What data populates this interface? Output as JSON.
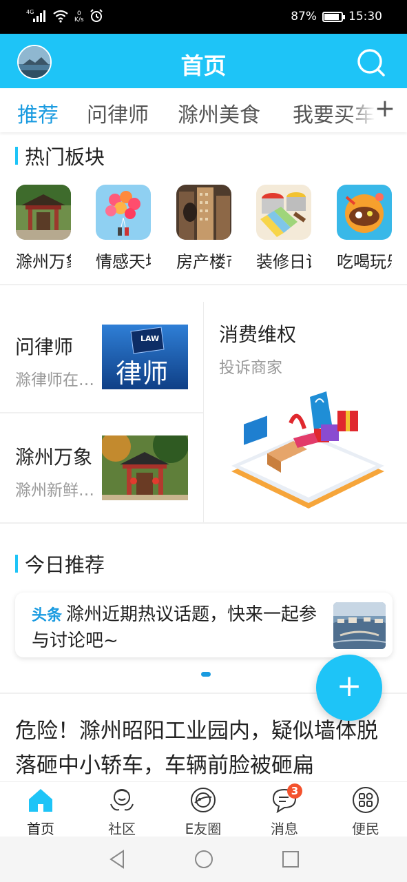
{
  "status_bar": {
    "network": "4G",
    "speed_value": "0",
    "speed_unit": "K/s",
    "battery_percent": 87,
    "battery_label": "87%",
    "time": "15:30",
    "icons": [
      "signal-icon",
      "wifi-icon",
      "alarm-icon",
      "battery-icon"
    ]
  },
  "header": {
    "title": "首页",
    "icons": [
      "avatar",
      "search-icon"
    ]
  },
  "tabs": {
    "items": [
      {
        "label": "推荐",
        "active": true
      },
      {
        "label": "问律师",
        "active": false
      },
      {
        "label": "滁州美食",
        "active": false
      },
      {
        "label": "我要买车",
        "active": false
      }
    ],
    "add_label": "+"
  },
  "hot_section": {
    "title": "热门板块",
    "boards": [
      {
        "label": "滁州万象",
        "icon": "pavilion-image"
      },
      {
        "label": "情感天地",
        "icon": "balloons-image"
      },
      {
        "label": "房产楼市",
        "icon": "buildings-image"
      },
      {
        "label": "装修日记",
        "icon": "paint-cans-image"
      },
      {
        "label": "吃喝玩乐",
        "icon": "food-image"
      }
    ]
  },
  "services": {
    "lawyer": {
      "title": "问律师",
      "subtitle": "滁律师在线…",
      "image_text": "律师",
      "image_tag": "LAW"
    },
    "wanxiang": {
      "title": "滁州万象",
      "subtitle": "滁州新鲜事…"
    },
    "consumer": {
      "title": "消费维权",
      "subtitle": "投诉商家"
    }
  },
  "today_section": {
    "title": "今日推荐",
    "card": {
      "tag": "头条",
      "text": "滁州近期热议话题，快来一起参与讨论吧~"
    }
  },
  "news": {
    "headline": "危险！滁州昭阳工业园内，疑似墙体脱落砸中小轿车，车辆前脸被砸扁"
  },
  "fab": {
    "label": "+"
  },
  "bottom_nav": {
    "items": [
      {
        "label": "首页",
        "icon": "home-icon",
        "active": true
      },
      {
        "label": "社区",
        "icon": "community-icon",
        "active": false
      },
      {
        "label": "E友圈",
        "icon": "planet-icon",
        "active": false
      },
      {
        "label": "消息",
        "icon": "message-icon",
        "active": false,
        "badge": "3"
      },
      {
        "label": "便民",
        "icon": "apps-icon",
        "active": false
      }
    ]
  },
  "system_nav": {
    "icons": [
      "back-icon",
      "home-circle-icon",
      "recents-icon"
    ]
  },
  "colors": {
    "primary": "#1ec4f7",
    "active_tab": "#1a9be0",
    "badge": "#f4522d",
    "text": "#222222",
    "muted": "#9a9a9a"
  }
}
